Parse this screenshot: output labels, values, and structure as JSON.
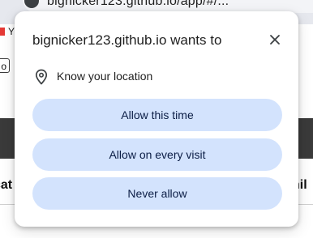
{
  "background": {
    "url_text": "bignicker123.github.io/app/#/...",
    "bookmark_text": "Y",
    "select_text": "o",
    "heading_left": "cat",
    "heading_right": "nil"
  },
  "dialog": {
    "title": "bignicker123.github.io wants to",
    "close_icon": "close-icon",
    "permission": {
      "icon": "location-pin-icon",
      "label": "Know your location"
    },
    "buttons": {
      "allow_once": "Allow this time",
      "allow_always": "Allow on every visit",
      "never": "Never allow"
    }
  },
  "colors": {
    "button_bg": "#d3e3fd",
    "button_text": "#0b1d45",
    "dark_bar": "#3a3a3a"
  }
}
